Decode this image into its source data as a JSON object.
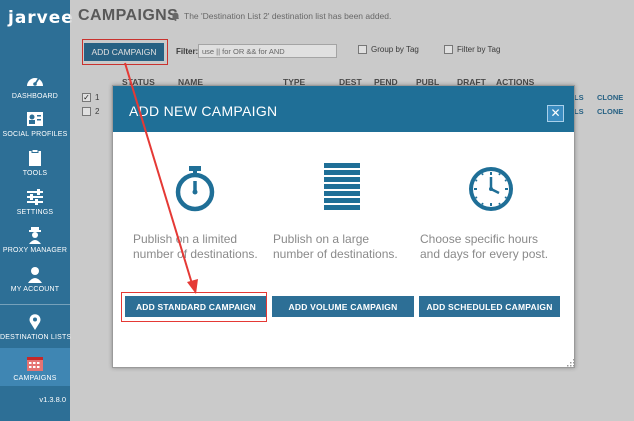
{
  "app": {
    "logo": "jarvee",
    "version": "v1.3.8.0"
  },
  "sidebar": {
    "items": [
      {
        "label": "DASHBOARD",
        "icon": "speedometer-icon"
      },
      {
        "label": "SOCIAL PROFILES",
        "icon": "profile-card-icon"
      },
      {
        "label": "TOOLS",
        "icon": "clipboard-icon"
      },
      {
        "label": "SETTINGS",
        "icon": "sliders-icon"
      },
      {
        "label": "PROXY MANAGER",
        "icon": "proxy-user-icon"
      },
      {
        "label": "MY ACCOUNT",
        "icon": "user-icon"
      },
      {
        "label": "DESTINATION LISTS",
        "icon": "map-pin-icon"
      },
      {
        "label": "CAMPAIGNS",
        "icon": "calendar-icon"
      }
    ]
  },
  "header": {
    "title": "CAMPAIGNS",
    "notification": "The 'Destination List 2' destination list has been added."
  },
  "toolbar": {
    "add_campaign": "ADD CAMPAIGN",
    "filter_label": "Filter:",
    "filter_placeholder": "use || for OR && for AND",
    "group_by_tag": "Group by Tag",
    "filter_by_tag": "Filter by Tag"
  },
  "table": {
    "columns": [
      "STATUS",
      "NAME",
      "TYPE",
      "DEST",
      "PEND",
      "PUBL",
      "DRAFT",
      "ACTIONS"
    ],
    "rows": [
      {
        "num": "1",
        "checked": true,
        "actions": [
          "LS",
          "CLONE"
        ]
      },
      {
        "num": "2",
        "checked": false,
        "actions": [
          "LS",
          "CLONE"
        ]
      }
    ]
  },
  "modal": {
    "title": "ADD NEW CAMPAIGN",
    "close": "✕",
    "options": [
      {
        "icon": "stopwatch-icon",
        "description": "Publish on a limited number of destinations.",
        "button": "ADD STANDARD CAMPAIGN"
      },
      {
        "icon": "stack-list-icon",
        "description": "Publish on a large number of destinations.",
        "button": "ADD VOLUME CAMPAIGN"
      },
      {
        "icon": "clock-icon",
        "description": "Choose specific hours and days for every post.",
        "button": "ADD SCHEDULED CAMPAIGN"
      }
    ]
  },
  "colors": {
    "sidebar": "#2d6f96",
    "modal_header": "#1f6f97",
    "button": "#1f6f97",
    "highlight": "#e53935"
  }
}
